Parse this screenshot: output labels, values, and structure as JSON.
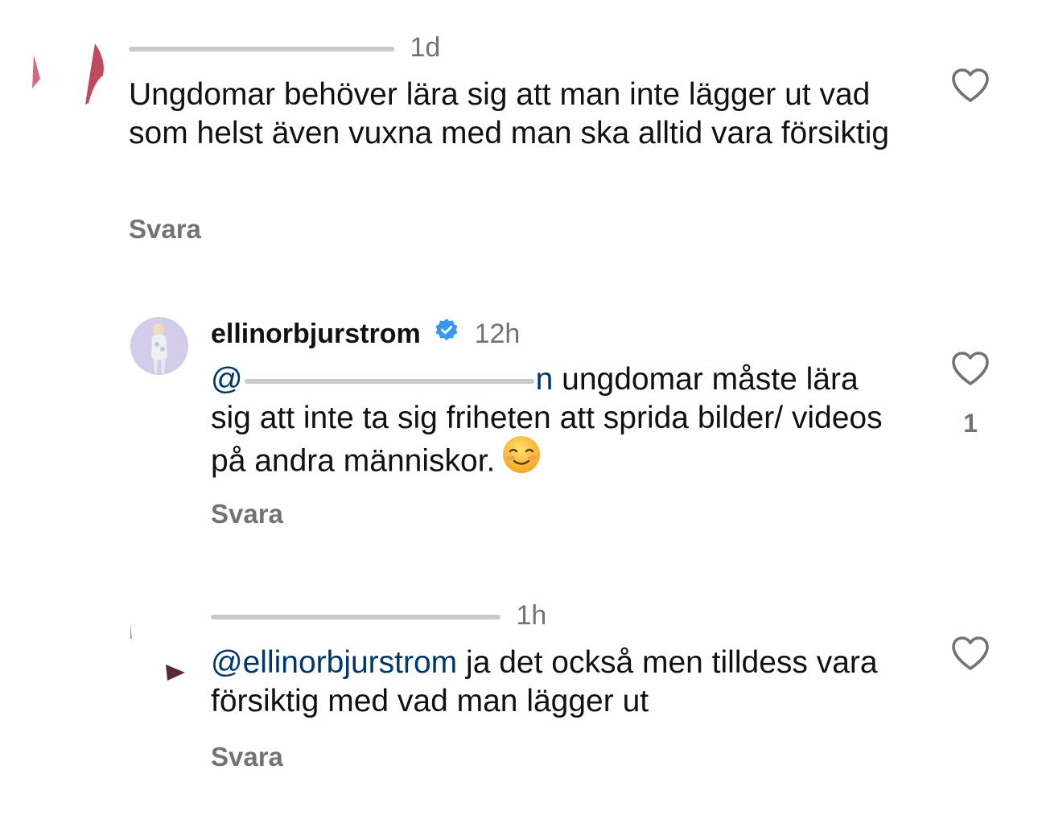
{
  "colors": {
    "text": "#111111",
    "secondary": "#737373",
    "mention": "#00376b",
    "verified": "#3897f0"
  },
  "comments": [
    {
      "username": "",
      "time": "1d",
      "text": "Ungdomar behöver lära sig att man inte lägger ut vad som helst även vuxna med man ska alltid vara försiktig",
      "reply_label": "Svara",
      "like_icon": "heart-outline-icon",
      "like_count": ""
    },
    {
      "username": "ellinorbjurstrom",
      "verified": true,
      "time": "12h",
      "mention": "@",
      "mention_tail": "n",
      "text": " ungdomar måste lära sig att inte ta sig friheten att sprida bilder/ videos på andra människor.",
      "emoji": "☺️",
      "reply_label": "Svara",
      "like_icon": "heart-outline-icon",
      "like_count": "1"
    },
    {
      "username": "",
      "time": "1h",
      "mention": "@ellinorbjurstrom",
      "text": " ja det också men tilldess vara försiktig med vad man lägger ut",
      "reply_label": "Svara",
      "like_icon": "heart-outline-icon",
      "like_count": ""
    }
  ]
}
